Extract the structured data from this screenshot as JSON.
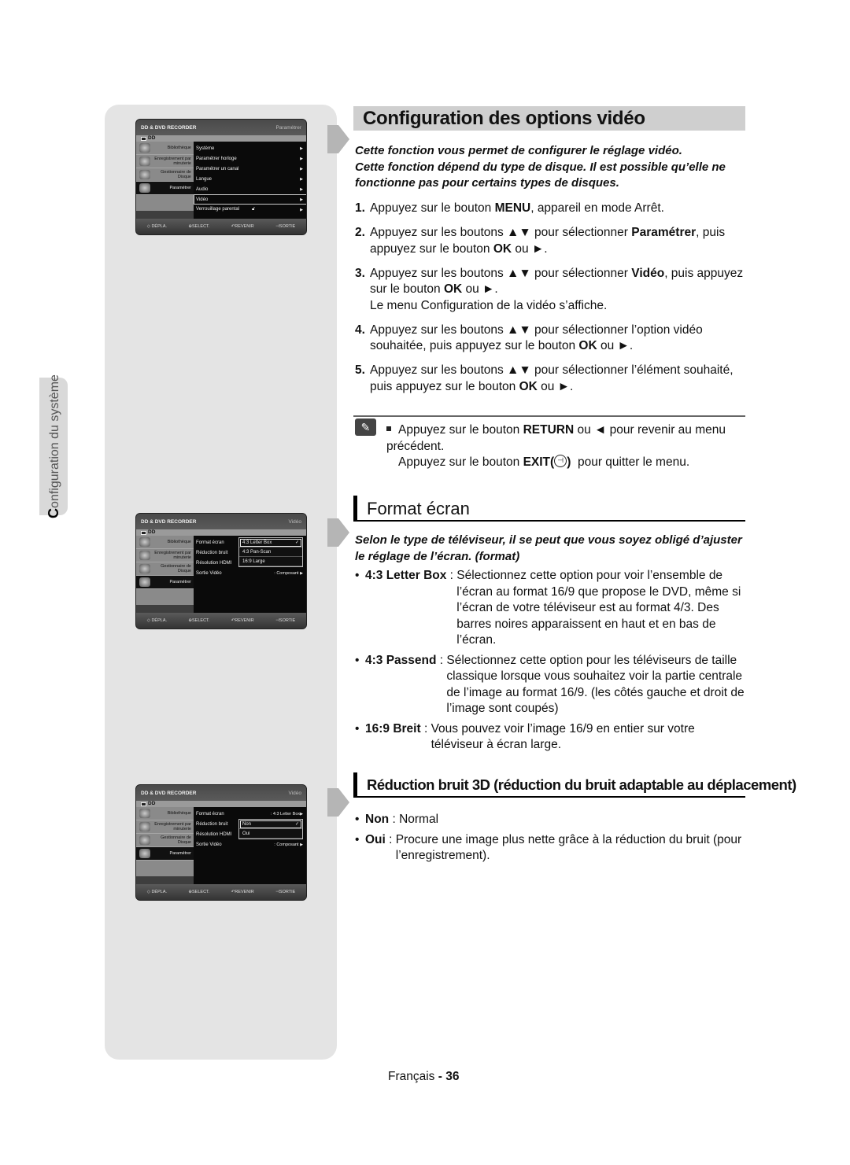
{
  "side_tab": {
    "first_letter": "C",
    "rest": "onfiguration du système"
  },
  "osd_common": {
    "header": "DD & DVD RECORDER",
    "dd_label": "DD",
    "left_menu": [
      {
        "label": "Bibliothèque",
        "icon": "library-icon"
      },
      {
        "label": "Enregistrement par minuterie",
        "icon": "timer-record-icon"
      },
      {
        "label": "Gestionnaire de Disque",
        "icon": "disc-manager-icon"
      },
      {
        "label": "Paramétrer",
        "icon": "settings-icon",
        "selected": true
      }
    ],
    "footer": [
      "◇ DÉPLA.",
      "⊕SELECT.",
      "↶REVENIR",
      "⊣SORTIE"
    ]
  },
  "osd1": {
    "crumb": "Paramétrer",
    "rows": [
      {
        "label": "Système"
      },
      {
        "label": "Paramétrer horloge"
      },
      {
        "label": "Paramétrer un canal"
      },
      {
        "label": "Langue"
      },
      {
        "label": "Audio"
      },
      {
        "label": "Vidéo",
        "highlighted": true
      },
      {
        "label": "Verrouillage parental",
        "lock": true
      }
    ]
  },
  "osd2": {
    "crumb": "Vidéo",
    "rows": [
      {
        "label": "Format écran",
        "value": ""
      },
      {
        "label": "Réduction bruit",
        "value": ""
      },
      {
        "label": "Résolution HDMI",
        "value": ""
      },
      {
        "label": "Sortie Vidéo",
        "value": ": Composant"
      }
    ],
    "popup": [
      {
        "label": "4:3 Letter Box",
        "checked": true
      },
      {
        "label": "4:3 Pan-Scan"
      },
      {
        "label": "16:9 Large"
      }
    ]
  },
  "osd3": {
    "crumb": "Vidéo",
    "rows": [
      {
        "label": "Format écran",
        "value": ": 4:3 Letter Box"
      },
      {
        "label": "Réduction bruit",
        "value": ""
      },
      {
        "label": "Résolution HDMI",
        "value": ""
      },
      {
        "label": "Sortie Vidéo",
        "value": ": Composant"
      }
    ],
    "popup": [
      {
        "label": "Non",
        "checked": true
      },
      {
        "label": "Oui"
      }
    ]
  },
  "section_main": {
    "title": "Configuration des options vidéo",
    "intro": [
      "Cette fonction vous permet de configurer le réglage vidéo.",
      "Cette fonction dépend du type de disque. Il est possible qu’elle ne fonctionne pas pour certains types de disques."
    ],
    "steps": [
      {
        "num": "1.",
        "parts": [
          [
            "Appuyez sur le bouton ",
            false
          ],
          [
            "MENU",
            true
          ],
          [
            ", appareil en mode Arrêt.",
            false
          ]
        ]
      },
      {
        "num": "2.",
        "parts": [
          [
            "Appuyez sur les boutons ▲▼ pour sélectionner ",
            false
          ],
          [
            "Paramétrer",
            true
          ],
          [
            ", puis appuyez sur le bouton ",
            false
          ],
          [
            "OK",
            true
          ],
          [
            " ou ►.",
            false
          ]
        ]
      },
      {
        "num": "3.",
        "parts": [
          [
            "Appuyez sur les boutons ▲▼ pour sélectionner ",
            false
          ],
          [
            "Vidéo",
            true
          ],
          [
            ", puis appuyez sur le bouton ",
            false
          ],
          [
            "OK",
            true
          ],
          [
            " ou ►.",
            false
          ]
        ],
        "extra": "Le menu Configuration de la vidéo s’affiche."
      },
      {
        "num": "4.",
        "parts": [
          [
            "Appuyez sur les boutons ▲▼ pour sélectionner l’option vidéo souhaitée, puis appuyez sur le bouton ",
            false
          ],
          [
            "OK",
            true
          ],
          [
            " ou ►.",
            false
          ]
        ]
      },
      {
        "num": "5.",
        "parts": [
          [
            "Appuyez sur les boutons ▲▼ pour sélectionner l’élément souhaité, puis appuyez sur le bouton ",
            false
          ],
          [
            "OK",
            true
          ],
          [
            " ou ►.",
            false
          ]
        ]
      }
    ],
    "note": {
      "line1_a": "Appuyez sur le bouton ",
      "line1_b": "RETURN",
      "line1_c": " ou ◄ pour revenir au menu précédent.",
      "line2_a": "Appuyez sur le bouton ",
      "line2_b": "EXIT(",
      "line2_c": ")",
      "line2_d": "  pour quitter le menu."
    }
  },
  "section_format": {
    "title": "Format écran",
    "intro": "Selon le type de téléviseur, il se peut que vous soyez obligé d’ajuster le réglage de l’écran. (format)",
    "options": [
      {
        "term": "4:3 Letter Box",
        "sep": " : ",
        "desc": "Sélectionnez cette option pour voir l’ensemble de l’écran au format 16/9 que propose le DVD, même si l’écran de votre téléviseur est au format 4/3. Des barres noires apparaissent en haut et en bas de l’écran."
      },
      {
        "term": "4:3 Passend",
        "sep": " : ",
        "desc": "Sélectionnez cette option pour les téléviseurs de taille classique lorsque vous souhaitez voir la partie centrale de l’image au format 16/9. (les côtés gauche et droit de l’image sont coupés)"
      },
      {
        "term": "16:9 Breit",
        "sep": " : ",
        "desc": "Vous pouvez voir l’image 16/9 en entier sur votre téléviseur à écran large."
      }
    ]
  },
  "section_noise": {
    "title": "Réduction bruit 3D (réduction du bruit adaptable au déplacement)",
    "options": [
      {
        "term": "Non",
        "sep": " : ",
        "desc": "Normal"
      },
      {
        "term": "Oui",
        "sep": " : ",
        "desc": "Procure une image plus nette grâce à la réduction du bruit (pour l’enregistrement)."
      }
    ]
  },
  "footer": {
    "language": "Français",
    "dash": " - ",
    "page": "36"
  }
}
